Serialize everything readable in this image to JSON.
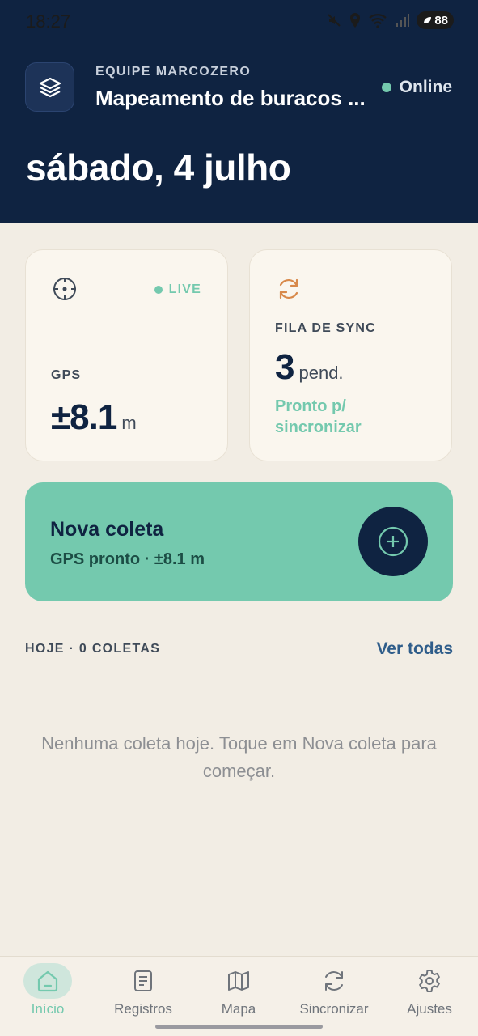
{
  "status_bar": {
    "time": "18:27",
    "battery": "88"
  },
  "header": {
    "team": "EQUIPE MARCOZERO",
    "project": "Mapeamento de buracos ...",
    "connection": "Online",
    "date": "sábado, 4 julho"
  },
  "gps_card": {
    "badge": "LIVE",
    "label": "GPS",
    "value": "±8.1",
    "unit": "m"
  },
  "sync_card": {
    "label": "FILA DE SYNC",
    "value": "3",
    "unit": "pend.",
    "status": "Pronto p/ sincronizar"
  },
  "new_collection": {
    "title": "Nova coleta",
    "subtitle": "GPS pronto · ±8.1 m"
  },
  "today": {
    "label": "HOJE · 0 COLETAS",
    "see_all": "Ver todas",
    "empty_message": "Nenhuma coleta hoje. Toque em Nova coleta para começar."
  },
  "nav": [
    {
      "label": "Início",
      "icon": "home-icon",
      "active": true
    },
    {
      "label": "Registros",
      "icon": "document-icon",
      "active": false
    },
    {
      "label": "Mapa",
      "icon": "map-icon",
      "active": false
    },
    {
      "label": "Sincronizar",
      "icon": "sync-icon",
      "active": false
    },
    {
      "label": "Ajustes",
      "icon": "gear-icon",
      "active": false
    }
  ],
  "colors": {
    "navy": "#0f2341",
    "accent": "#74c9ae",
    "link": "#2f5d8a",
    "sync_orange": "#d8894a"
  }
}
